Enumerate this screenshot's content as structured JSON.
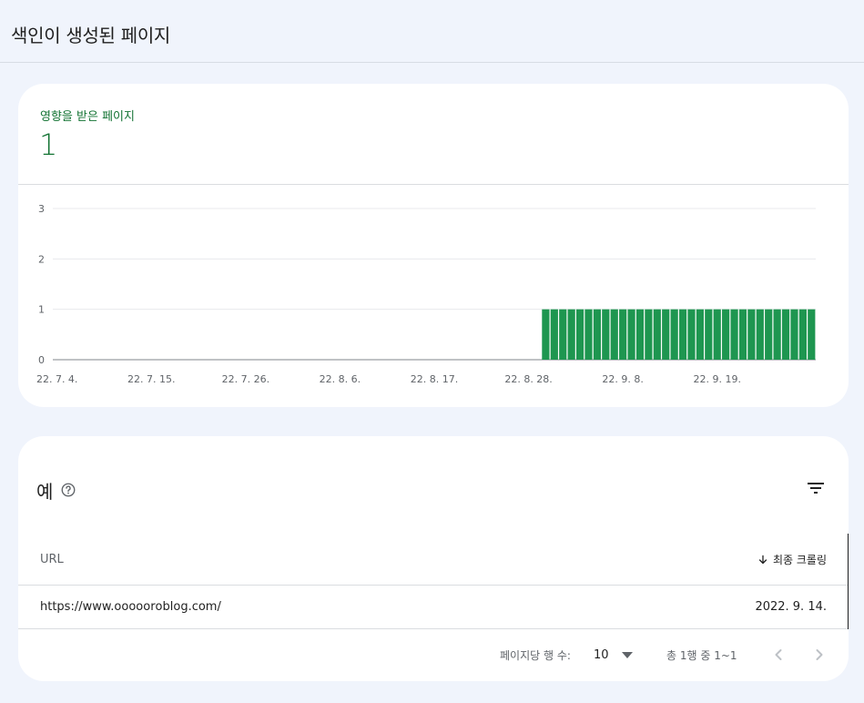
{
  "header": {
    "title": "색인이 생성된 페이지"
  },
  "summary": {
    "metric_label": "영향을 받은 페이지",
    "metric_value": "1"
  },
  "colors": {
    "accent_green": "#137333",
    "bar_green": "#1e9650",
    "text_grey": "#5f6368"
  },
  "chart_data": {
    "type": "bar",
    "title": "",
    "xlabel": "",
    "ylabel": "",
    "ylim": [
      0,
      3
    ],
    "yticks": [
      "0",
      "1",
      "2",
      "3"
    ],
    "grid": true,
    "xticks": [
      "22. 7. 4.",
      "22. 7. 15.",
      "22. 7. 26.",
      "22. 8. 6.",
      "22. 8. 17.",
      "22. 8. 28.",
      "22. 9. 8.",
      "22. 9. 19."
    ],
    "x_start": "22. 7. 4.",
    "x_end": "22. 9. 27.",
    "series": [
      {
        "values": [
          0,
          0,
          0,
          0,
          0,
          0,
          0,
          0,
          0,
          0,
          0,
          0,
          0,
          0,
          0,
          0,
          0,
          0,
          0,
          0,
          0,
          0,
          0,
          0,
          0,
          0,
          0,
          0,
          0,
          0,
          0,
          0,
          0,
          0,
          0,
          0,
          0,
          0,
          0,
          0,
          0,
          0,
          0,
          0,
          0,
          0,
          0,
          0,
          0,
          0,
          0,
          0,
          0,
          0,
          0,
          0,
          0,
          1,
          1,
          1,
          1,
          1,
          1,
          1,
          1,
          1,
          1,
          1,
          1,
          1,
          1,
          1,
          1,
          1,
          1,
          1,
          1,
          1,
          1,
          1,
          1,
          1,
          1,
          1,
          1,
          1,
          1,
          1,
          1
        ]
      }
    ]
  },
  "examples": {
    "title": "예",
    "icons": {
      "help": "help-circle-icon",
      "filter": "filter-icon",
      "sort": "arrow-down-icon",
      "prev": "chevron-left-icon",
      "next": "chevron-right-icon",
      "dropdown": "caret-down-icon"
    },
    "columns": {
      "url": "URL",
      "last_crawl": "최종 크롤링"
    },
    "rows": [
      {
        "url": "https://www.ooooorоblog.com/",
        "last_crawl": "2022. 9. 14."
      }
    ],
    "pagination": {
      "rows_per_page_label": "페이지당 행 수:",
      "rows_per_page_value": "10",
      "range_text": "총 1행 중 1~1"
    }
  }
}
